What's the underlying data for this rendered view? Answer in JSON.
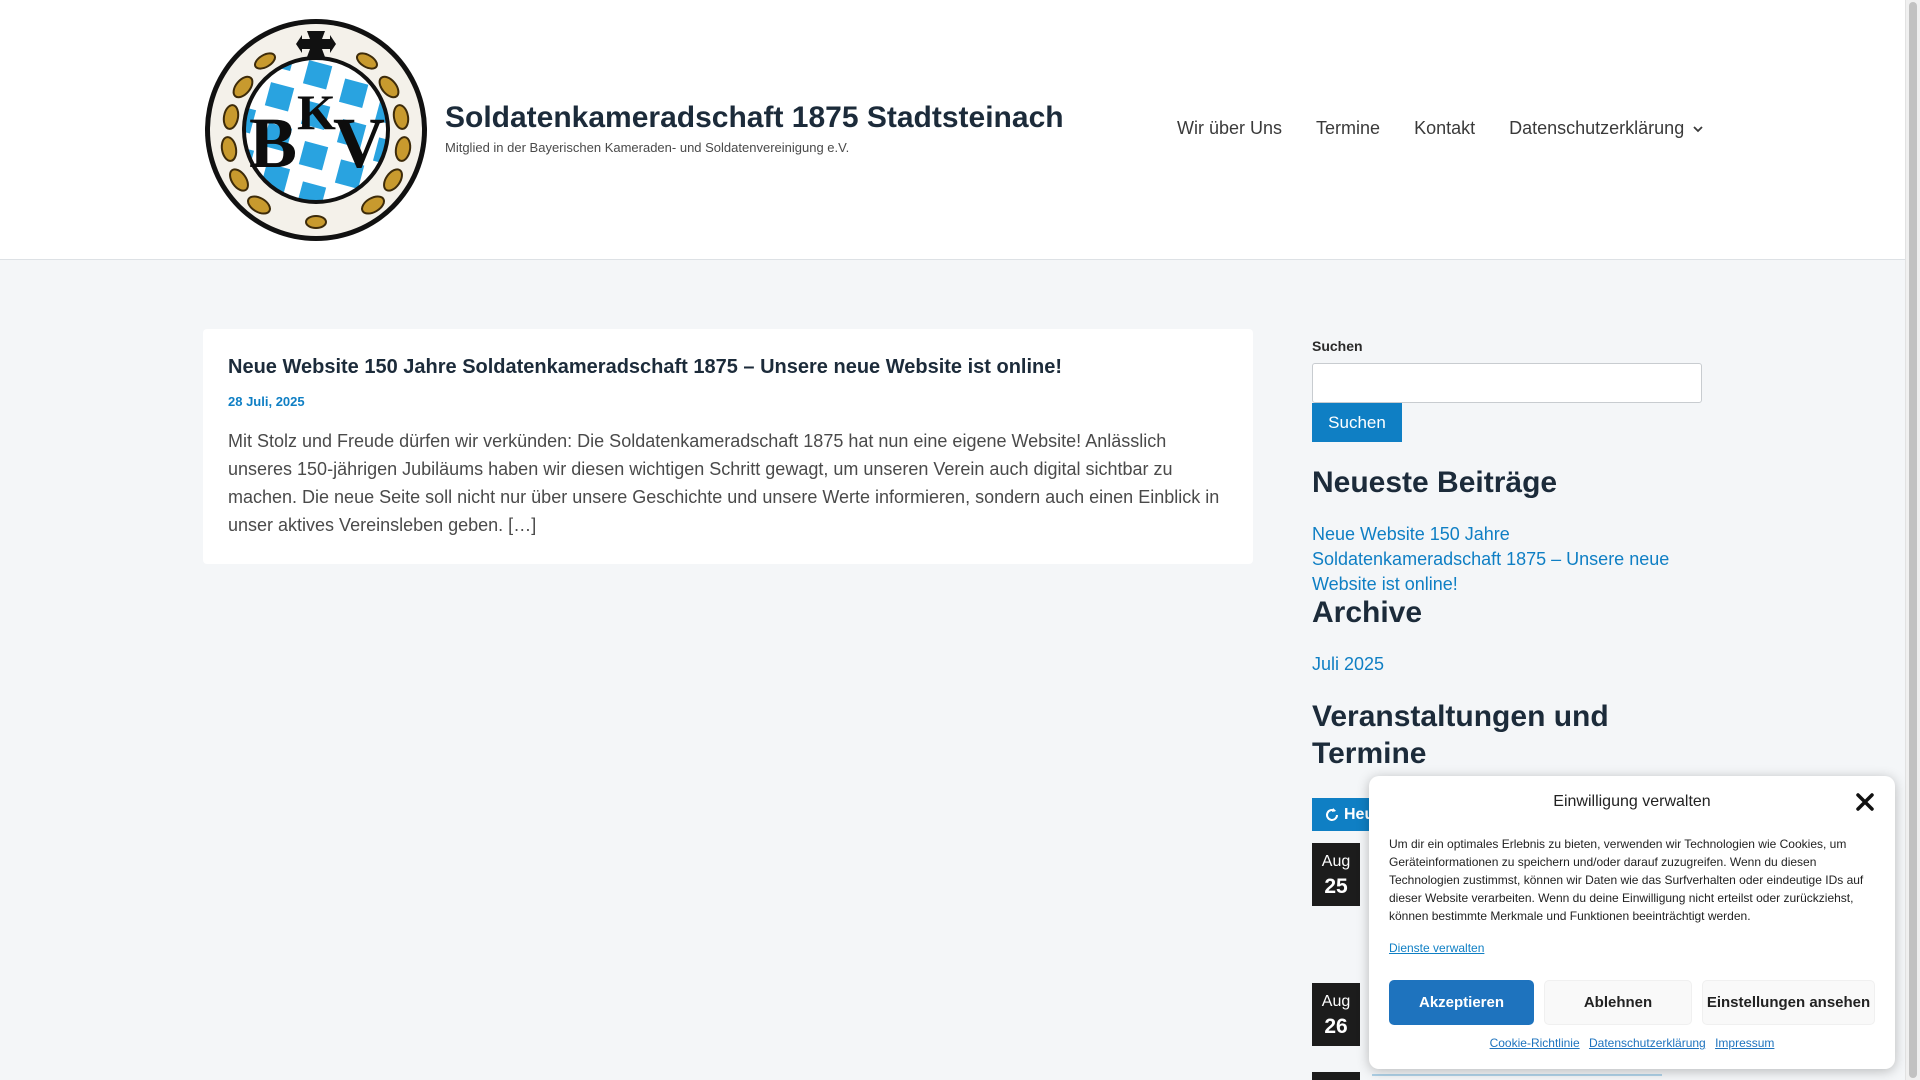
{
  "colors": {
    "accent": "#0f7fc4",
    "title": "#1c2b3a",
    "badge": "#1c1c1c",
    "accept_button": "#1e73be"
  },
  "header": {
    "site_title": "Soldatenkameradschaft 1875 Stadtsteinach",
    "tagline": "Mitglied in der Bayerischen Kameraden- und Soldatenvereinigung e.V.",
    "logo_letters": "BKV",
    "nav": [
      {
        "label": "Wir über Uns"
      },
      {
        "label": "Termine"
      },
      {
        "label": "Kontakt"
      },
      {
        "label": "Datenschutzerklärung",
        "icon": "chevron-down-icon"
      }
    ]
  },
  "post": {
    "title": "Neue Website 150 Jahre Soldatenkameradschaft 1875 – Unsere neue Website ist online!",
    "date": "28 Juli, 2025",
    "excerpt": "Mit Stolz und Freude dürfen wir verkünden: Die Soldatenkameradschaft 1875 hat nun eine eigene Website! Anlässlich unseres 150-jährigen Jubiläums haben wir diesen wichtigen Schritt gewagt, um unseren Verein auch digital sichtbar zu machen. Die neue Seite soll nicht nur über unsere Geschichte und unsere Werte informieren, sondern auch einen Einblick in unser aktives Vereinsleben geben. […]"
  },
  "sidebar": {
    "search_label": "Suchen",
    "search_value": "",
    "search_button": "Suchen",
    "recent_title": "Neueste Beiträge",
    "recent_link": "Neue Website 150 Jahre Soldatenkameradschaft 1875 – Unsere neue Website ist online!",
    "archive_title": "Archive",
    "archive_link": "Juli 2025",
    "events_title": "Veranstaltungen und Termine",
    "today_button": "Heu",
    "today_icon": "refresh-icon",
    "events": [
      {
        "month": "Aug",
        "day": "25"
      },
      {
        "month": "Aug",
        "day": "26"
      }
    ]
  },
  "consent": {
    "title": "Einwilligung verwalten",
    "body": "Um dir ein optimales Erlebnis zu bieten, verwenden wir Technologien wie Cookies, um Geräteinformationen zu speichern und/oder darauf zuzugreifen. Wenn du diesen Technologien zustimmst, können wir Daten wie das Surfverhalten oder eindeutige IDs auf dieser Website verarbeiten. Wenn du deine Einwilligung nicht erteilst oder zurückziehst, können bestimmte Merkmale und Funktionen beeinträchtigt werden.",
    "manage_link": "Dienste verwalten",
    "accept": "Akzeptieren",
    "deny": "Ablehnen",
    "view": "Einstellungen ansehen",
    "links": [
      "Cookie-Richtlinie",
      "Datenschutzerklärung",
      "Impressum"
    ]
  }
}
